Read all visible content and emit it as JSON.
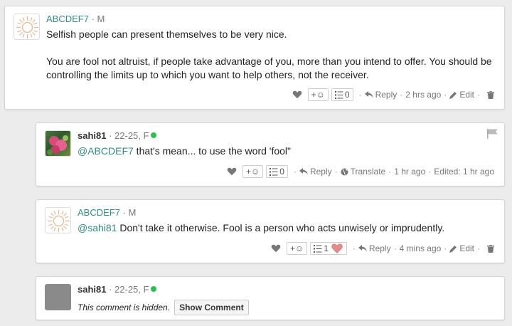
{
  "comments": [
    {
      "username": "ABCDEF7",
      "meta": " · M",
      "lines": [
        "Selfish people can present themselves to be very nice.",
        "You are fool not altruist, if people take advantage of you, more than you intend to offer. You should be",
        "controlling the limits up to which you want to help others, not the receiver."
      ],
      "react_label": "+☺",
      "list_count": "0",
      "reply": "Reply",
      "time": "2 hrs ago",
      "edit": "Edit"
    },
    {
      "username": "sahi81",
      "meta": " · 22-25, F",
      "mention": "@ABCDEF7",
      "text": " that's mean... to use the word 'fool\"",
      "react_label": "+☺",
      "list_count": "0",
      "reply": "Reply",
      "translate": "Translate",
      "time": "1 hr ago",
      "edited": "Edited: 1 hr ago"
    },
    {
      "username": "ABCDEF7",
      "meta": " · M",
      "mention": "@sahi81",
      "text": " Don't take it otherwise. Fool is a person who acts unwisely or imprudently.",
      "react_label": "+☺",
      "list_count": "1",
      "reply": "Reply",
      "time": "4 mins ago",
      "edit": "Edit"
    },
    {
      "username": "sahi81",
      "meta": " · 22-25, F",
      "hidden_text": "This comment is hidden.",
      "show_label": "Show Comment"
    }
  ],
  "icons": {
    "heart": "heart-icon",
    "reply": "reply-arrow-icon",
    "edit": "pencil-icon",
    "delete": "trash-icon",
    "translate": "globe-icon",
    "flag": "flag-icon",
    "list": "list-icon",
    "emoji": "smiley-icon"
  },
  "colors": {
    "username_teal": "#2f8f86",
    "online": "#27c24c",
    "heart_filled": "#e88a8a"
  }
}
